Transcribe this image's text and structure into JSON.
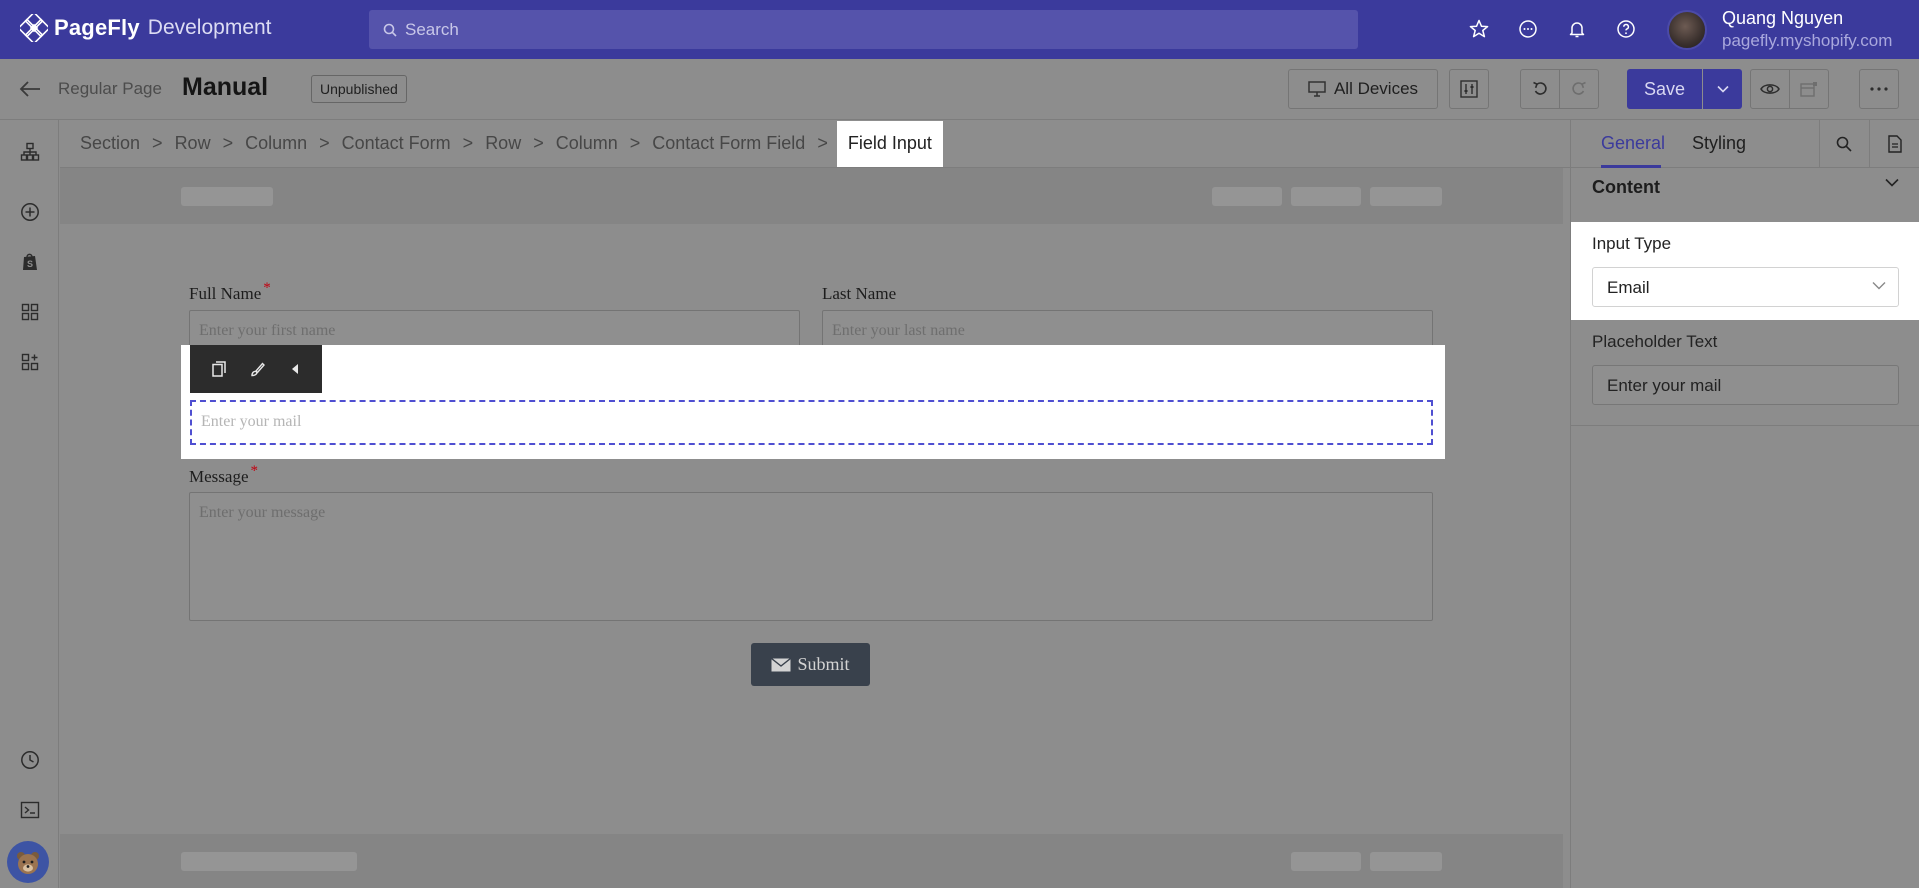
{
  "app": {
    "brand_name": "PageFly",
    "brand_env": "Development",
    "search_placeholder": "Search",
    "user_name": "Quang Nguyen",
    "user_store": "pagefly.myshopify.com"
  },
  "page": {
    "type": "Regular Page",
    "title": "Manual",
    "status": "Unpublished",
    "device_label": "All Devices",
    "save_label": "Save"
  },
  "breadcrumb": {
    "items": [
      "Section",
      "Row",
      "Column",
      "Contact Form",
      "Row",
      "Column",
      "Contact Form Field"
    ],
    "active": "Field Input",
    "separator": ">"
  },
  "form": {
    "full_name_label": "Full Name",
    "full_name_placeholder": "Enter your first name",
    "last_name_label": "Last Name",
    "last_name_placeholder": "Enter your last name",
    "email_placeholder": "Enter your mail",
    "message_label": "Message",
    "message_placeholder": "Enter your message",
    "required_mark": "*",
    "submit_label": "Submit"
  },
  "panel": {
    "tab_general": "General",
    "tab_styling": "Styling",
    "section_title": "Content",
    "input_type_label": "Input Type",
    "input_type_value": "Email",
    "placeholder_label": "Placeholder Text",
    "placeholder_value": "Enter your mail"
  },
  "colors": {
    "brand": "#3b3a9c",
    "selection_outline": "#4f4fd1",
    "required": "#c2000f"
  },
  "icons": {
    "top_right": [
      "star-icon",
      "chat-icon",
      "bell-icon",
      "help-icon"
    ],
    "left_rail": [
      "layers-icon",
      "add-icon",
      "shopify-icon",
      "grid-icon",
      "apps-icon",
      "history-icon",
      "terminal-icon"
    ]
  }
}
